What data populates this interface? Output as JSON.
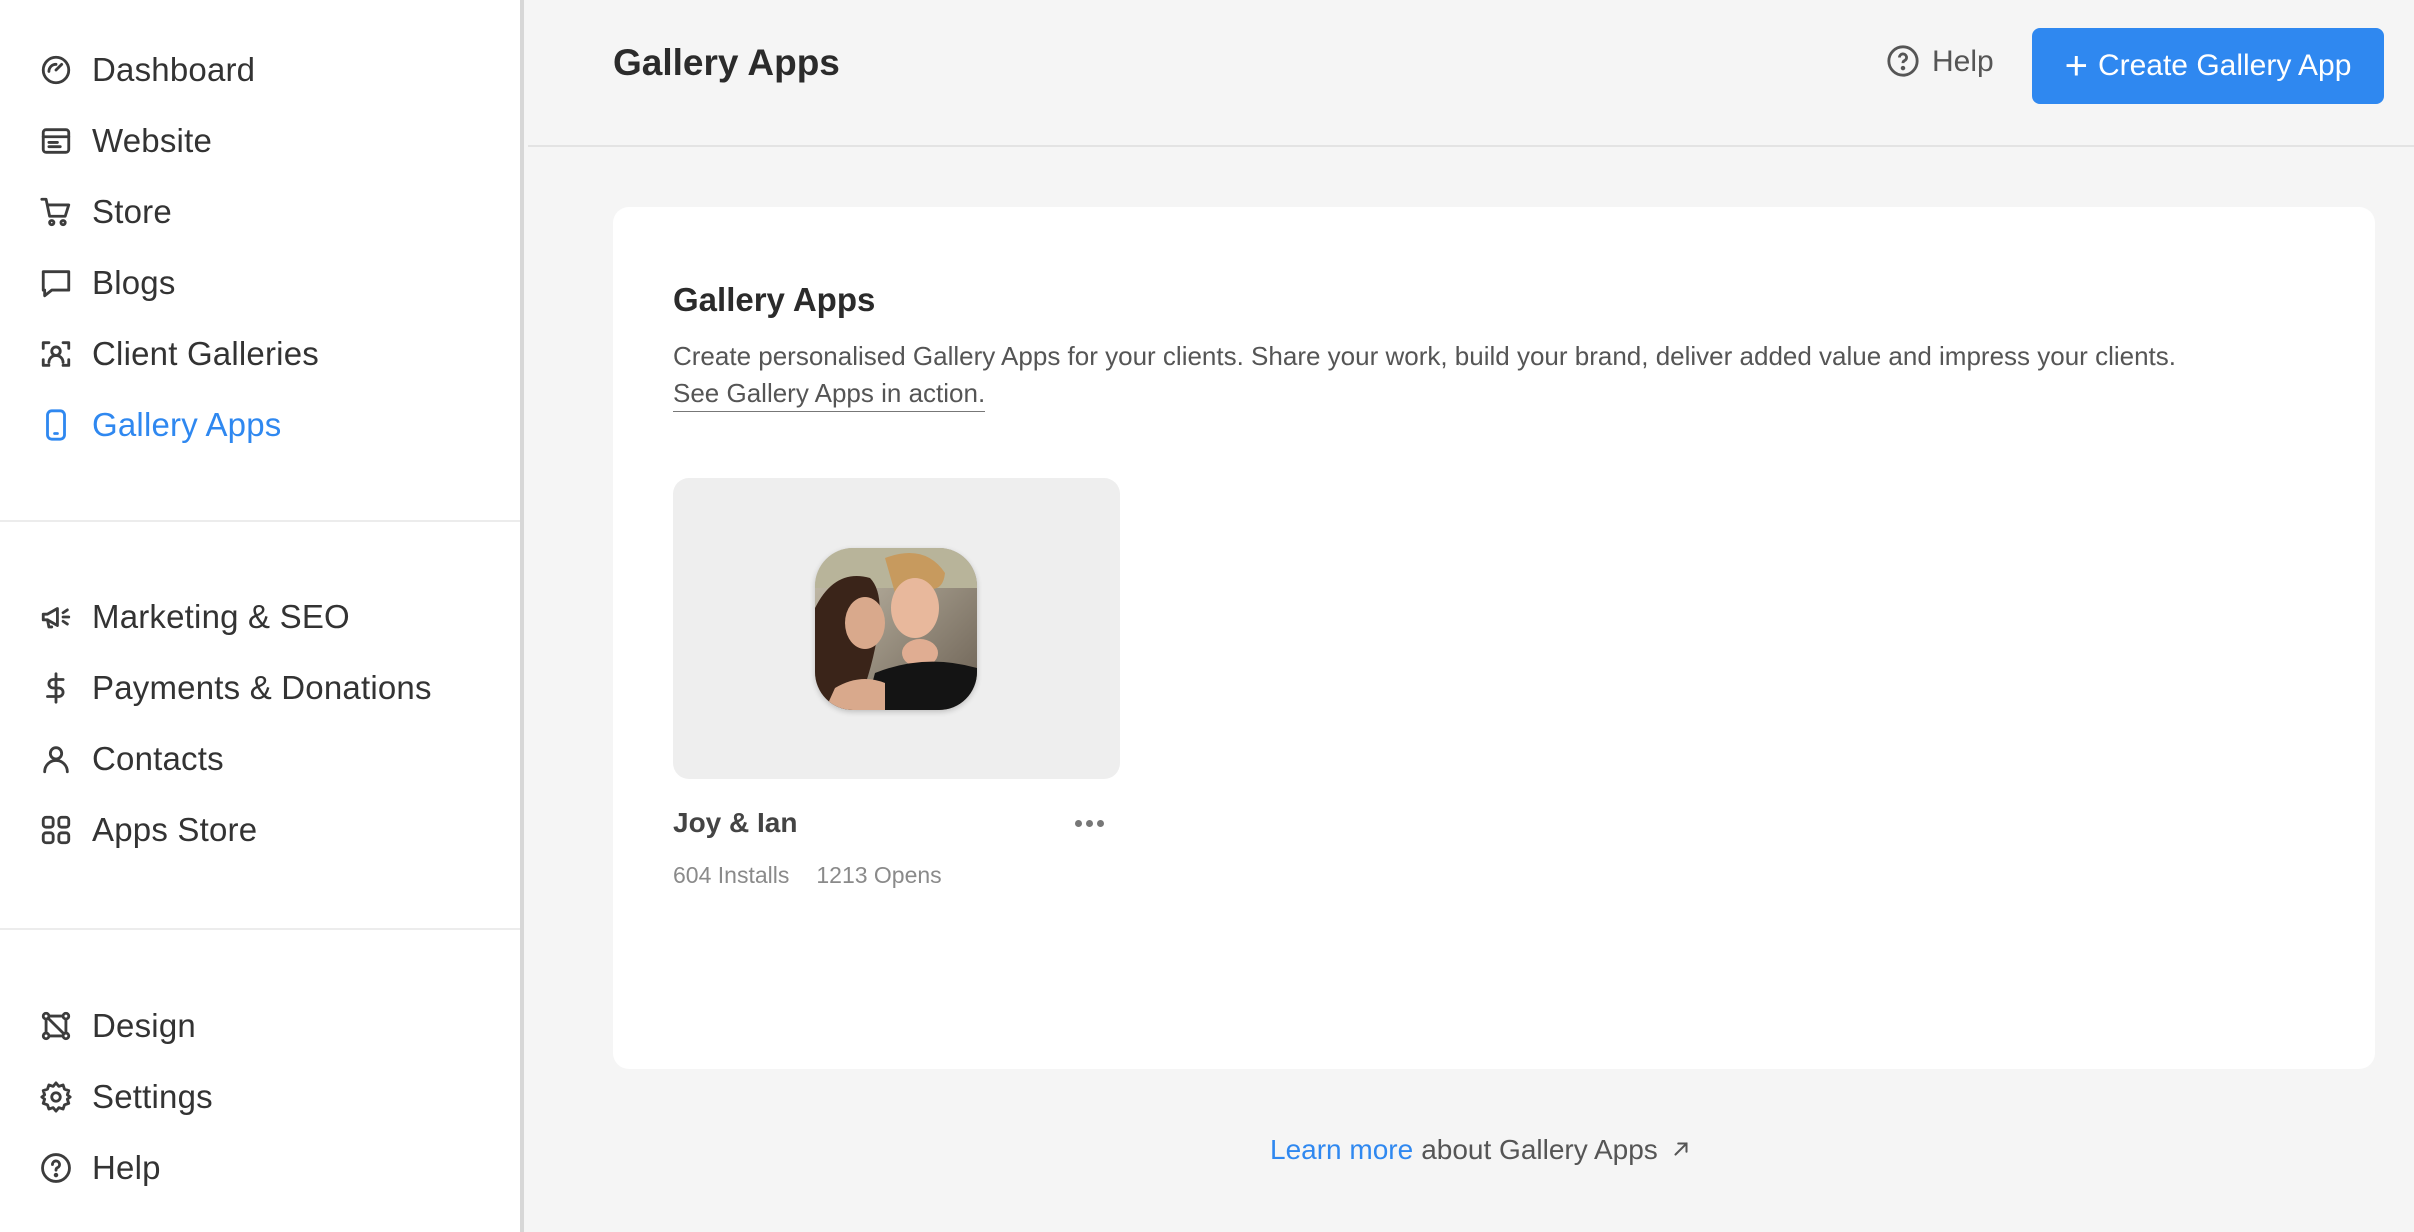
{
  "sidebar": {
    "group1": [
      {
        "label": "Dashboard",
        "icon": "dashboard-icon"
      },
      {
        "label": "Website",
        "icon": "website-icon"
      },
      {
        "label": "Store",
        "icon": "cart-icon"
      },
      {
        "label": "Blogs",
        "icon": "chat-bubble-icon"
      },
      {
        "label": "Client Galleries",
        "icon": "face-scan-icon"
      },
      {
        "label": "Gallery Apps",
        "icon": "phone-icon",
        "active": true
      }
    ],
    "group2": [
      {
        "label": "Marketing & SEO",
        "icon": "megaphone-icon"
      },
      {
        "label": "Payments & Donations",
        "icon": "dollar-icon"
      },
      {
        "label": "Contacts",
        "icon": "person-icon"
      },
      {
        "label": "Apps Store",
        "icon": "grid-icon"
      }
    ],
    "group3": [
      {
        "label": "Design",
        "icon": "design-nodes-icon"
      },
      {
        "label": "Settings",
        "icon": "gear-icon"
      },
      {
        "label": "Help",
        "icon": "help-circle-icon"
      }
    ]
  },
  "header": {
    "title": "Gallery Apps",
    "help_label": "Help",
    "create_label": "Create Gallery App"
  },
  "card": {
    "title": "Gallery Apps",
    "description": "Create personalised Gallery Apps for your clients. Share your work, build your brand, deliver added value and impress your clients.",
    "link_label": "See Gallery Apps in action."
  },
  "apps": [
    {
      "name": "Joy & Ian",
      "installs": "604 Installs",
      "opens": "1213 Opens"
    }
  ],
  "footer": {
    "learn_more": "Learn more",
    "suffix": "about Gallery Apps"
  },
  "colors": {
    "accent": "#2f88f0"
  }
}
